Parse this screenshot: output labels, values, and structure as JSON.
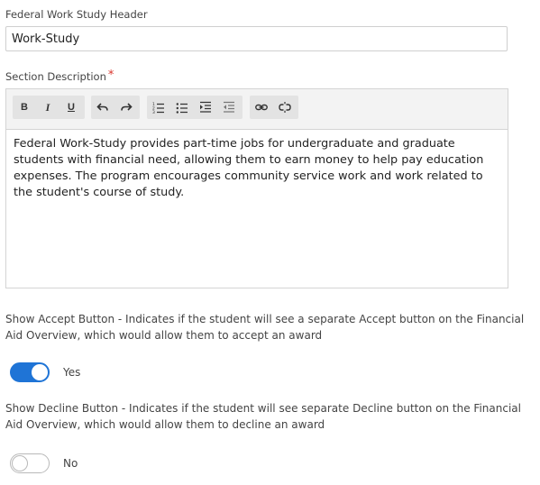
{
  "header_field": {
    "label": "Federal Work Study Header",
    "value": "Work-Study"
  },
  "section_description": {
    "label": "Section Description",
    "required_marker": "*",
    "toolbar": {
      "bold": "B",
      "italic": "I",
      "underline": "U",
      "icons": [
        "undo-icon",
        "redo-icon",
        "ordered-list-icon",
        "unordered-list-icon",
        "indent-icon",
        "outdent-icon",
        "link-icon",
        "unlink-icon"
      ]
    },
    "content": "Federal Work-Study provides part-time jobs for undergraduate and graduate students with financial need, allowing them to earn money to help pay education expenses. The program encourages community service work and work related to the student's course of study."
  },
  "accept_button_setting": {
    "description": "Show Accept Button - Indicates if the student will see a separate Accept button on the Financial Aid Overview, which would allow them to accept an award",
    "enabled": true,
    "state_label": "Yes"
  },
  "decline_button_setting": {
    "description": "Show Decline Button - Indicates if the student will see separate Decline button on the Financial Aid Overview, which would allow them to decline an award",
    "enabled": false,
    "state_label": "No"
  },
  "colors": {
    "toggle_on": "#1f74d6",
    "required": "#d9342b"
  }
}
